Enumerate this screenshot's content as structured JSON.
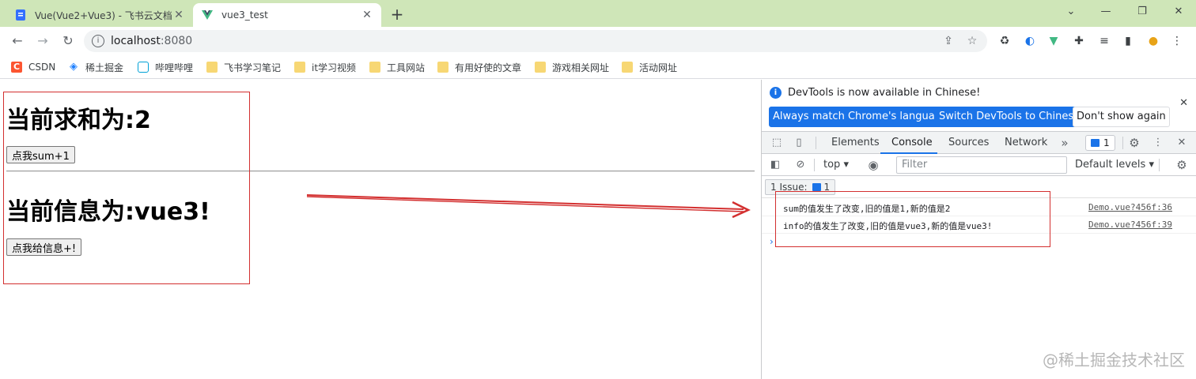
{
  "tabs": [
    {
      "title": "Vue(Vue2+Vue3) - 飞书云文档",
      "favicon": "feishu-doc-icon"
    },
    {
      "title": "vue3_test",
      "favicon": "vue-logo-icon"
    }
  ],
  "address": {
    "host": "localhost",
    "port": ":8080"
  },
  "bookmarks": [
    {
      "label": "CSDN",
      "icon": "csdn-icon"
    },
    {
      "label": "稀土掘金",
      "icon": "juejin-icon"
    },
    {
      "label": "哔哩哔哩",
      "icon": "bilibili-icon"
    },
    {
      "label": "飞书学习笔记",
      "icon": "folder-icon"
    },
    {
      "label": "it学习视频",
      "icon": "folder-icon"
    },
    {
      "label": "工具网站",
      "icon": "folder-icon"
    },
    {
      "label": "有用好使的文章",
      "icon": "folder-icon"
    },
    {
      "label": "游戏相关网址",
      "icon": "folder-icon"
    },
    {
      "label": "活动网址",
      "icon": "folder-icon"
    }
  ],
  "page": {
    "sum_heading": "当前求和为:2",
    "sum_button": "点我sum+1",
    "info_heading": "当前信息为:vue3!",
    "info_button": "点我给信息+!"
  },
  "devtools": {
    "banner": "DevTools is now available in Chinese!",
    "btn_match": "Always match Chrome's language",
    "btn_switch": "Switch DevTools to Chinese",
    "btn_dont_show": "Don't show again",
    "tabs": [
      "Elements",
      "Console",
      "Sources",
      "Network"
    ],
    "active_tab": "Console",
    "issues_badge": "1",
    "context": "top",
    "filter_placeholder": "Filter",
    "levels": "Default levels",
    "issues_label": "1 Issue:",
    "issues_count": "1",
    "logs": [
      {
        "message": "sum的值发生了改变,旧的值是1,新的值是2",
        "source": "Demo.vue?456f:36"
      },
      {
        "message": "info的值发生了改变,旧的值是vue3,新的值是vue3!",
        "source": "Demo.vue?456f:39"
      }
    ],
    "prompt": "›"
  },
  "watermark": "@稀土掘金技术社区",
  "colors": {
    "tabstrip": "#cfe6b8",
    "annotation_red": "#d32f2f",
    "devtools_blue": "#1a73e8"
  }
}
